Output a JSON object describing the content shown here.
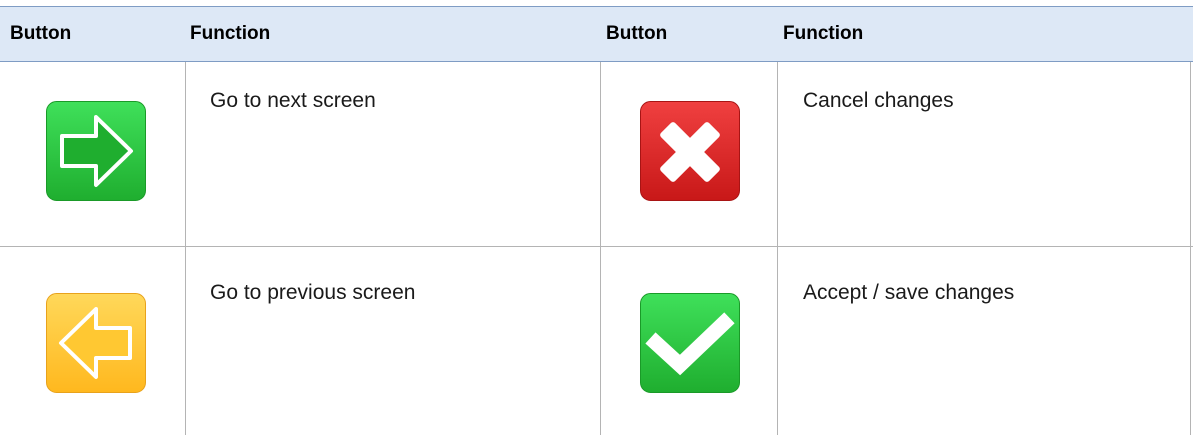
{
  "table": {
    "header": {
      "button_label_1": "Button",
      "function_label_1": "Function",
      "button_label_2": "Button",
      "function_label_2": "Function"
    },
    "rows": [
      {
        "left_icon": "next-arrow-icon",
        "left_function": "Go to next screen",
        "right_icon": "cancel-x-icon",
        "right_function": "Cancel changes"
      },
      {
        "left_icon": "previous-arrow-icon",
        "left_function": "Go to previous screen",
        "right_icon": "checkmark-icon",
        "right_function": "Accept / save changes"
      }
    ]
  },
  "colors": {
    "header_bg": "#dde8f6",
    "green_button": "#2ec43f",
    "red_button": "#e52a2a",
    "yellow_button": "#ffc832"
  }
}
